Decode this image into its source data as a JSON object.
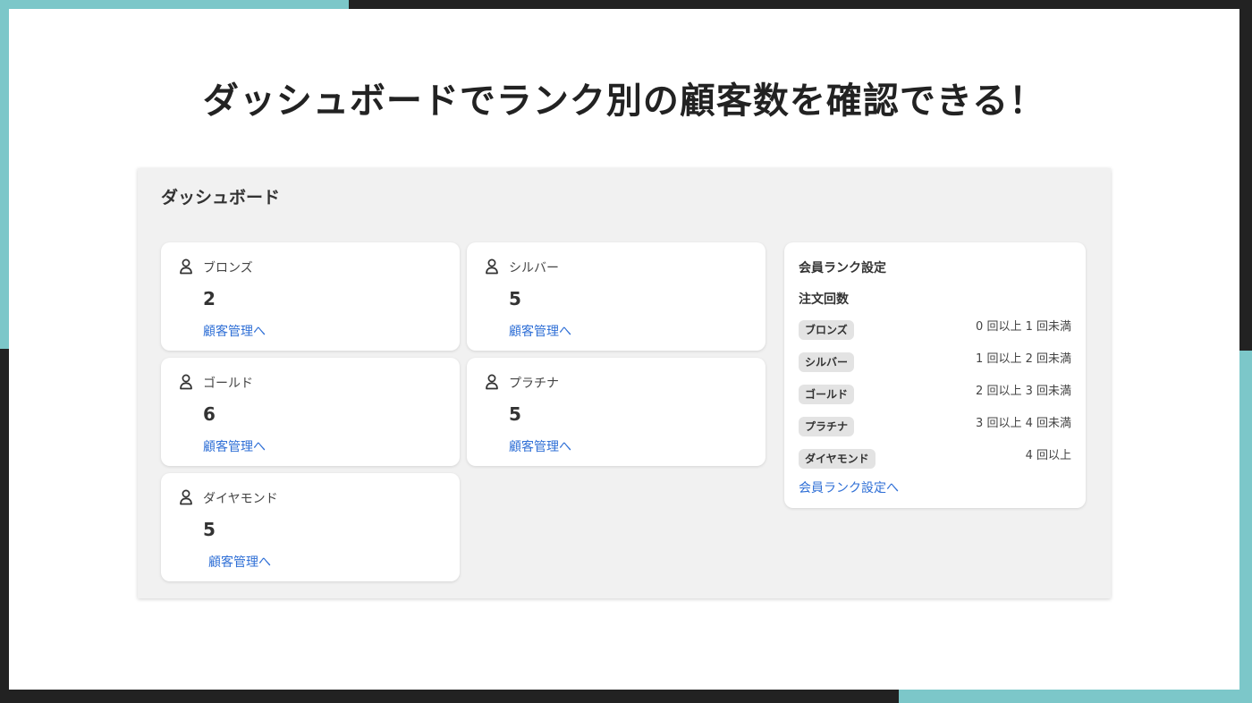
{
  "headline": "ダッシュボードでランク別の顧客数を確認できる！",
  "dashboard": {
    "title": "ダッシュボード",
    "cards": [
      {
        "rank": "ブロンズ",
        "count": "2",
        "link": "顧客管理へ",
        "icon": "person-icon"
      },
      {
        "rank": "シルバー",
        "count": "5",
        "link": "顧客管理へ",
        "icon": "person-icon"
      },
      {
        "rank": "ゴールド",
        "count": "6",
        "link": "顧客管理へ",
        "icon": "person-icon"
      },
      {
        "rank": "プラチナ",
        "count": "5",
        "link": "顧客管理へ",
        "icon": "person-icon"
      },
      {
        "rank": "ダイヤモンド",
        "count": "5",
        "link": "顧客管理へ",
        "icon": "person-icon"
      }
    ]
  },
  "rank_settings": {
    "title": "会員ランク設定",
    "subtitle": "注文回数",
    "rows": [
      {
        "rank": "ブロンズ",
        "range": "0 回以上 1 回未満"
      },
      {
        "rank": "シルバー",
        "range": "1 回以上 2 回未満"
      },
      {
        "rank": "ゴールド",
        "range": "2 回以上 3 回未満"
      },
      {
        "rank": "プラチナ",
        "range": "3 回以上 4 回未満"
      },
      {
        "rank": "ダイヤモンド",
        "range": "4 回以上"
      }
    ],
    "link": "会員ランク設定へ"
  },
  "colors": {
    "accent_teal": "#7cc7c9",
    "frame_dark": "#222222",
    "link_blue": "#2f6fd6",
    "panel_bg": "#f1f1f1"
  }
}
